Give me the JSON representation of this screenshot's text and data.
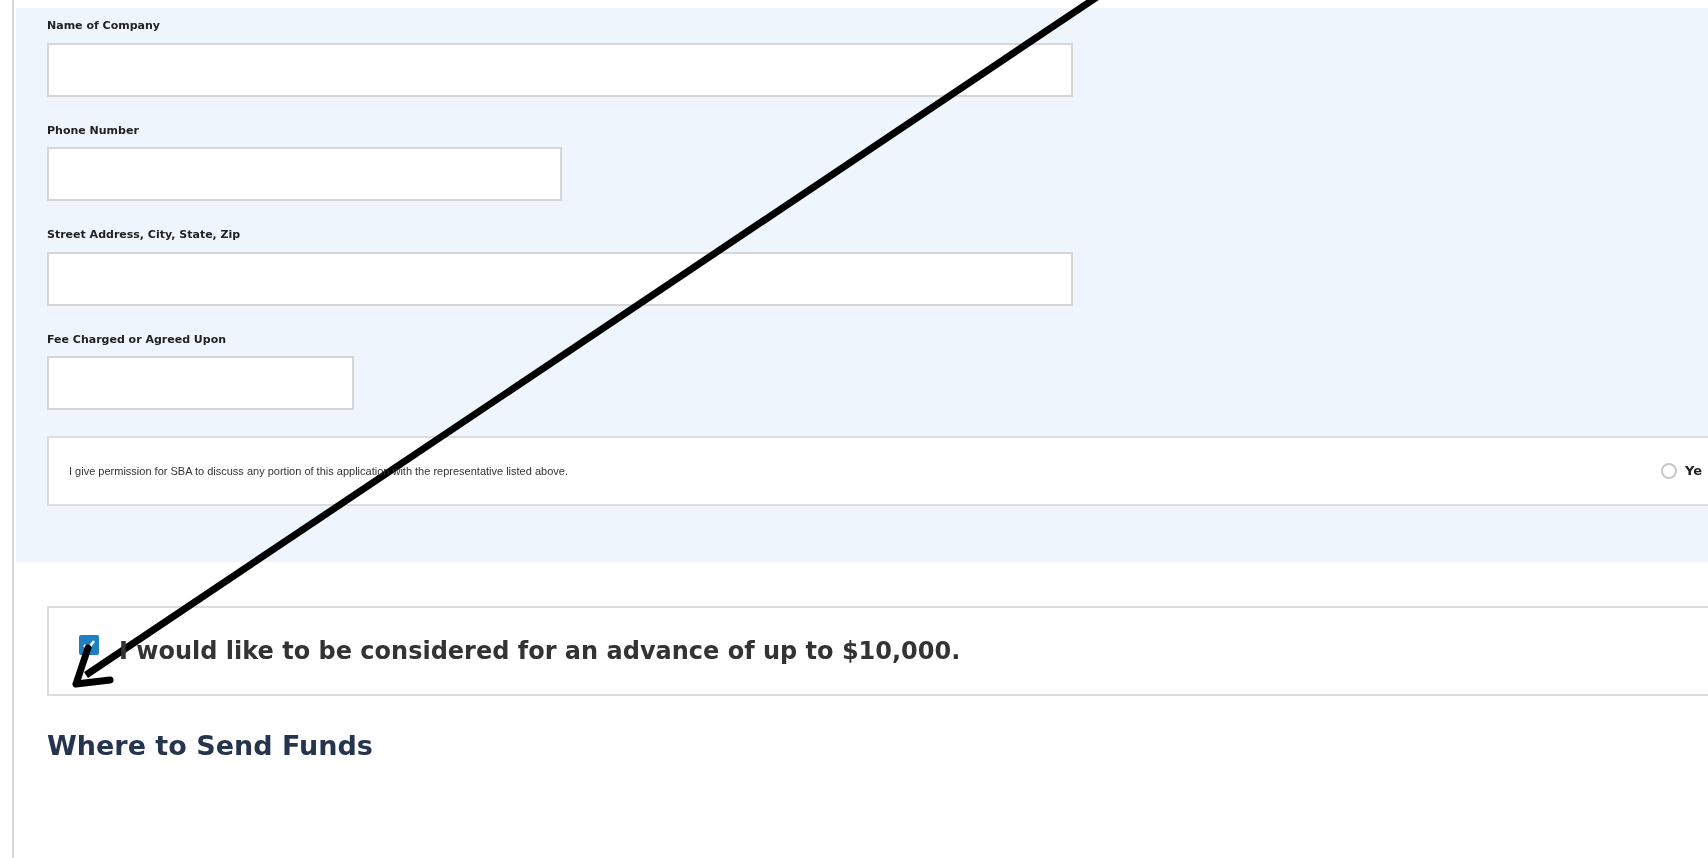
{
  "representative_fields": [
    {
      "label": "Name of Company"
    },
    {
      "label": "Phone Number"
    },
    {
      "label": "Street Address, City, State, Zip"
    },
    {
      "label": "Fee Charged or Agreed Upon"
    }
  ],
  "permission": {
    "text": "I give permission for SBA to discuss any portion of this application with the representative listed above.",
    "option": {
      "label": "Ye",
      "selected": false
    }
  },
  "advance": {
    "text": "I would like to be considered for an advance of up to $10,000.",
    "checked": true
  },
  "section_heading": "Where to Send Funds"
}
